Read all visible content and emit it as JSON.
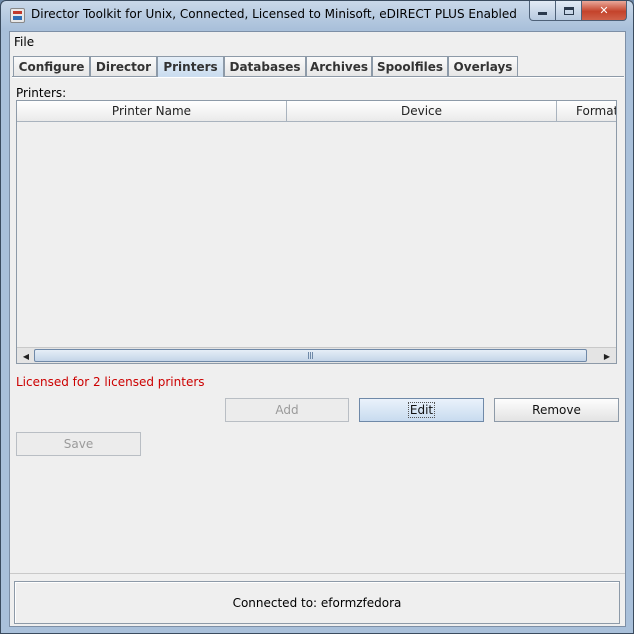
{
  "window": {
    "title": "Director Toolkit for Unix, Connected, Licensed to Minisoft, eDIRECT PLUS Enabled"
  },
  "menu": {
    "file": "File"
  },
  "tabs": [
    {
      "label": "Configure",
      "selected": false
    },
    {
      "label": "Director",
      "selected": false
    },
    {
      "label": "Printers",
      "selected": true
    },
    {
      "label": "Databases",
      "selected": false
    },
    {
      "label": "Archives",
      "selected": false
    },
    {
      "label": "Spoolfiles",
      "selected": false
    },
    {
      "label": "Overlays",
      "selected": false
    }
  ],
  "printers": {
    "label": "Printers:",
    "columns": [
      "Printer Name",
      "Device",
      "Format"
    ],
    "rows": [],
    "license_message": "Licensed for 2 licensed printers"
  },
  "buttons": {
    "add": "Add",
    "edit": "Edit",
    "remove": "Remove",
    "save": "Save"
  },
  "status": {
    "text": "Connected to: eformzfedora"
  },
  "colors": {
    "license_message": "#cc0000",
    "selected_tab": "#c9dcef",
    "title_bar": "#a9c0da"
  }
}
